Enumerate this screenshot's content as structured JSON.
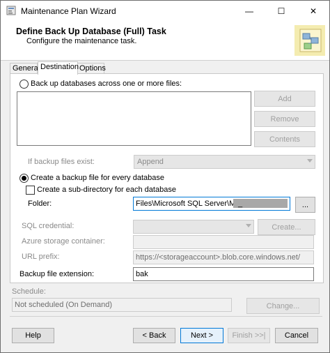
{
  "window": {
    "title": "Maintenance Plan Wizard",
    "minimize_glyph": "—",
    "maximize_glyph": "☐",
    "close_glyph": "✕"
  },
  "header": {
    "title": "Define Back Up Database (Full) Task",
    "subtitle": "Configure the maintenance task."
  },
  "tabs": [
    {
      "label": "General"
    },
    {
      "label": "Destination"
    },
    {
      "label": "Options"
    }
  ],
  "active_tab": "Destination",
  "destination": {
    "backup_across_files_label": "Back up databases across one or more files:",
    "add_button": "Add",
    "remove_button": "Remove",
    "contents_button": "Contents",
    "if_exists_label": "If backup files exist:",
    "if_exists_value": "Append",
    "create_file_label": "Create a backup file for every database",
    "create_subdir_label": "Create a sub-directory for each database",
    "folder_label": "Folder:",
    "folder_value": "Files\\Microsoft SQL Server\\MSSQL",
    "folder_redacted": "_",
    "browse_button": "...",
    "sql_credential_label": "SQL credential:",
    "sql_credential_value": "",
    "create_button": "Create...",
    "azure_container_label": "Azure storage container:",
    "azure_container_value": "",
    "url_prefix_label": "URL prefix:",
    "url_prefix_value": "https://<storageaccount>.blob.core.windows.net/",
    "extension_label": "Backup file extension:",
    "extension_value": "bak"
  },
  "schedule": {
    "label": "Schedule:",
    "value": "Not scheduled (On Demand)",
    "change_button": "Change..."
  },
  "footer": {
    "help": "Help",
    "back": "< Back",
    "next": "Next >",
    "finish": "Finish >>|",
    "cancel": "Cancel"
  },
  "state": {
    "backup_across_files_selected": false,
    "create_file_selected": true,
    "create_subdir_checked": false
  },
  "colors": {
    "accent": "#0078d7",
    "window_bg": "#f0f0f0",
    "disabled_text": "#8a8a8a"
  }
}
